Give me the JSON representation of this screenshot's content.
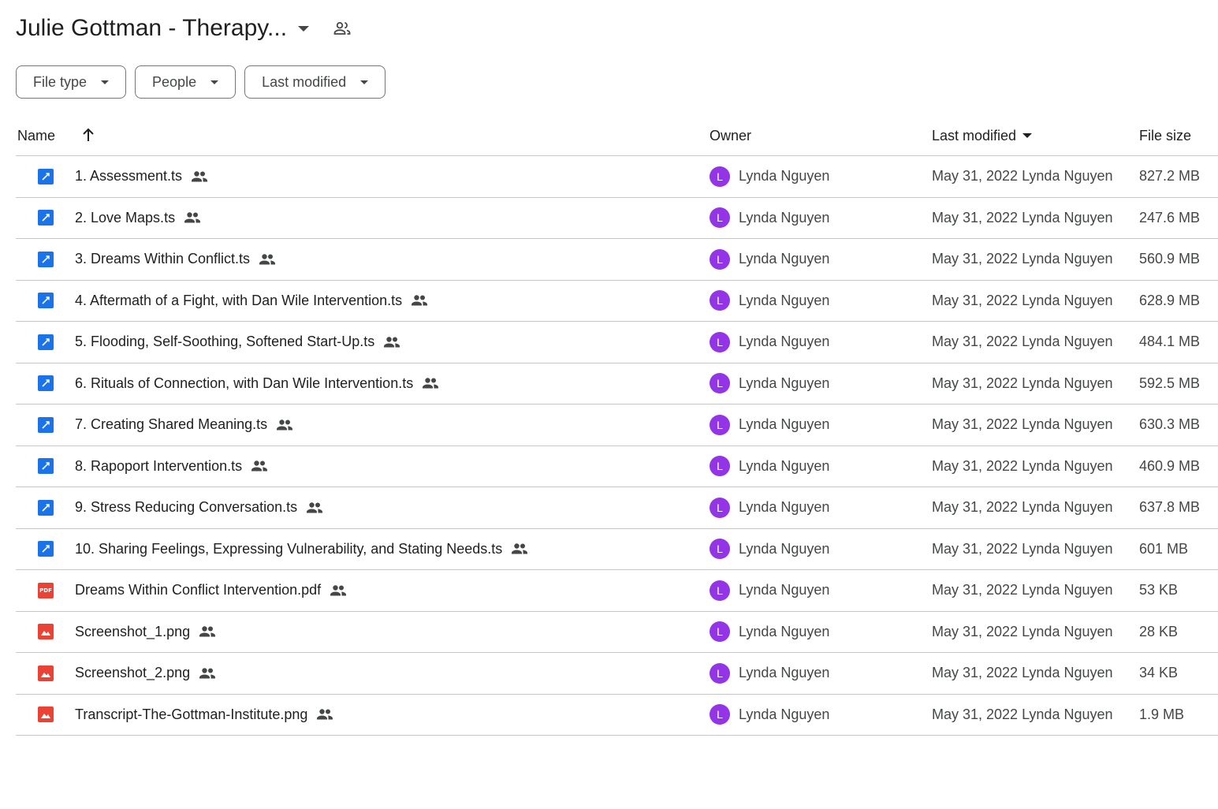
{
  "header": {
    "title": "Julie Gottman - Therapy..."
  },
  "filters": [
    {
      "label": "File type"
    },
    {
      "label": "People"
    },
    {
      "label": "Last modified"
    }
  ],
  "columns": {
    "name": "Name",
    "owner": "Owner",
    "last_modified": "Last modified",
    "file_size": "File size"
  },
  "files": [
    {
      "name": "1. Assessment.ts",
      "type": "video",
      "owner_initial": "L",
      "owner": "Lynda Nguyen",
      "modified": "May 31, 2022 Lynda Nguyen",
      "size": "827.2 MB"
    },
    {
      "name": "2. Love Maps.ts",
      "type": "video",
      "owner_initial": "L",
      "owner": "Lynda Nguyen",
      "modified": "May 31, 2022 Lynda Nguyen",
      "size": "247.6 MB"
    },
    {
      "name": "3. Dreams Within Conflict.ts",
      "type": "video",
      "owner_initial": "L",
      "owner": "Lynda Nguyen",
      "modified": "May 31, 2022 Lynda Nguyen",
      "size": "560.9 MB"
    },
    {
      "name": "4. Aftermath of a Fight, with Dan Wile Intervention.ts",
      "type": "video",
      "owner_initial": "L",
      "owner": "Lynda Nguyen",
      "modified": "May 31, 2022 Lynda Nguyen",
      "size": "628.9 MB"
    },
    {
      "name": "5. Flooding, Self-Soothing, Softened Start-Up.ts",
      "type": "video",
      "owner_initial": "L",
      "owner": "Lynda Nguyen",
      "modified": "May 31, 2022 Lynda Nguyen",
      "size": "484.1 MB"
    },
    {
      "name": "6. Rituals of Connection, with Dan Wile Intervention.ts",
      "type": "video",
      "owner_initial": "L",
      "owner": "Lynda Nguyen",
      "modified": "May 31, 2022 Lynda Nguyen",
      "size": "592.5 MB"
    },
    {
      "name": "7. Creating Shared Meaning.ts",
      "type": "video",
      "owner_initial": "L",
      "owner": "Lynda Nguyen",
      "modified": "May 31, 2022 Lynda Nguyen",
      "size": "630.3 MB"
    },
    {
      "name": "8. Rapoport Intervention.ts",
      "type": "video",
      "owner_initial": "L",
      "owner": "Lynda Nguyen",
      "modified": "May 31, 2022 Lynda Nguyen",
      "size": "460.9 MB"
    },
    {
      "name": "9. Stress Reducing Conversation.ts",
      "type": "video",
      "owner_initial": "L",
      "owner": "Lynda Nguyen",
      "modified": "May 31, 2022 Lynda Nguyen",
      "size": "637.8 MB"
    },
    {
      "name": "10. Sharing Feelings, Expressing Vulnerability, and Stating Needs.ts",
      "type": "video",
      "owner_initial": "L",
      "owner": "Lynda Nguyen",
      "modified": "May 31, 2022 Lynda Nguyen",
      "size": "601 MB"
    },
    {
      "name": "Dreams Within Conflict Intervention.pdf",
      "type": "pdf",
      "icon_label": "PDF",
      "owner_initial": "L",
      "owner": "Lynda Nguyen",
      "modified": "May 31, 2022 Lynda Nguyen",
      "size": "53 KB"
    },
    {
      "name": "Screenshot_1.png",
      "type": "image",
      "owner_initial": "L",
      "owner": "Lynda Nguyen",
      "modified": "May 31, 2022 Lynda Nguyen",
      "size": "28 KB"
    },
    {
      "name": "Screenshot_2.png",
      "type": "image",
      "owner_initial": "L",
      "owner": "Lynda Nguyen",
      "modified": "May 31, 2022 Lynda Nguyen",
      "size": "34 KB"
    },
    {
      "name": "Transcript-The-Gottman-Institute.png",
      "type": "image",
      "owner_initial": "L",
      "owner": "Lynda Nguyen",
      "modified": "May 31, 2022 Lynda Nguyen",
      "size": "1.9 MB"
    }
  ],
  "icons": {
    "shared": "people-icon",
    "sort": "arrow-up-icon",
    "video": "video-file-icon",
    "pdf": "pdf-file-icon",
    "image": "image-file-icon"
  },
  "colors": {
    "avatar": "#9334e6",
    "video_icon": "#1a73e8",
    "pdf_icon": "#ea4335",
    "image_icon": "#ea4335",
    "border": "#c7c7c7"
  }
}
